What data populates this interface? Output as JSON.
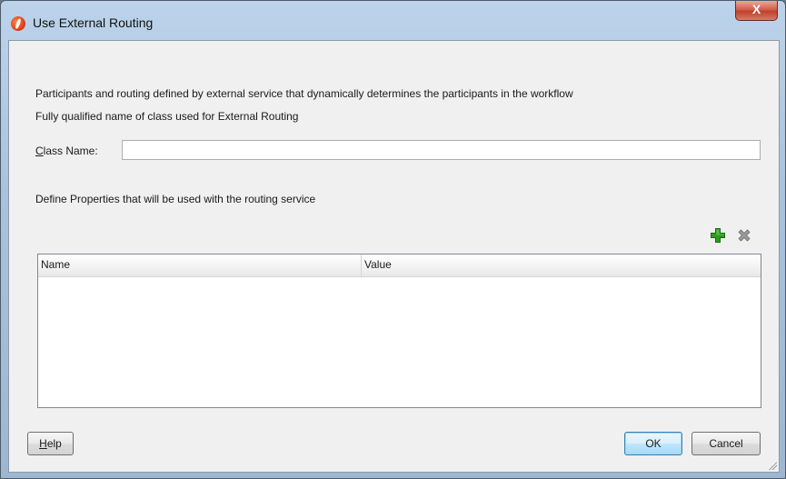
{
  "window": {
    "title": "Use External Routing",
    "close_label": "X"
  },
  "content": {
    "description_line1": "Participants and routing defined by external service that dynamically determines the participants in the workflow",
    "description_line2": "Fully qualified name of class used for External Routing",
    "class_name_label_prefix": "C",
    "class_name_label_rest": "lass Name:",
    "class_name_value": "",
    "properties_description": "Define Properties that will be used with the routing service"
  },
  "toolbar": {
    "add_icon": "plus-icon",
    "remove_icon": "x-icon"
  },
  "table": {
    "columns": [
      "Name",
      "Value"
    ],
    "rows": []
  },
  "buttons": {
    "help_prefix": "H",
    "help_rest": "elp",
    "ok": "OK",
    "cancel": "Cancel"
  },
  "colors": {
    "add_icon": "#2e9b1f",
    "remove_icon": "#8a8a8a",
    "close_button": "#c7432e"
  }
}
